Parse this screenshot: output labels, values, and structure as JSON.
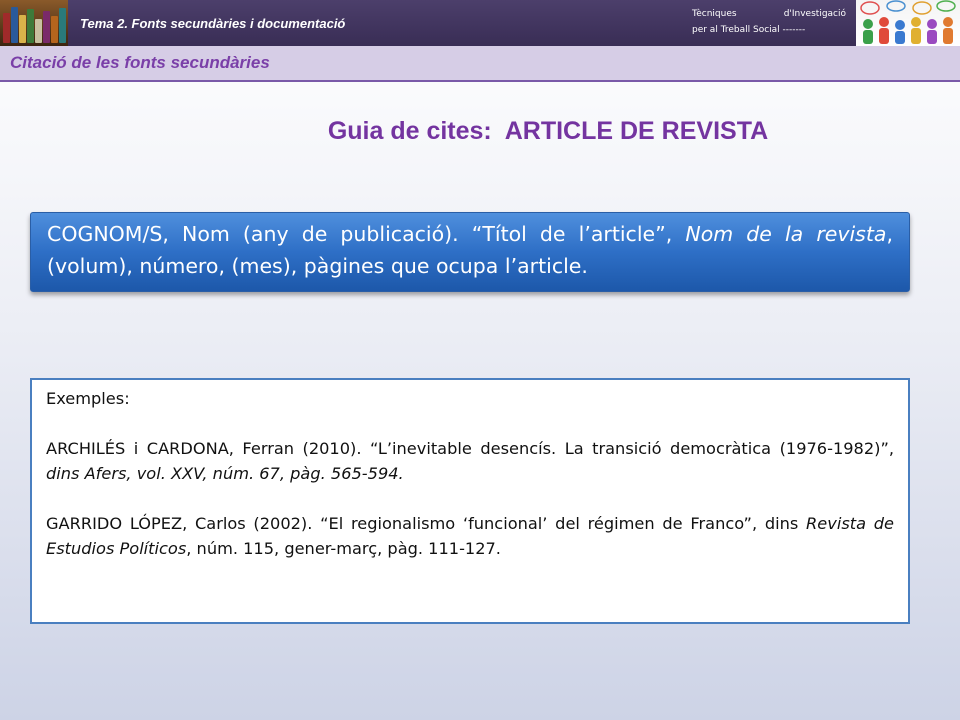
{
  "header": {
    "title": "Tema 2. Fonts secundàries i documentació",
    "course_line1_a": "Tècniques",
    "course_line1_b": "d'Investigació",
    "course_line2": "per al Treball Social -------"
  },
  "section": {
    "title": "Citació de les fonts secundàries"
  },
  "main": {
    "title_a": "Guia de cites:",
    "title_b": "ARTICLE DE REVISTA"
  },
  "format": {
    "part1": "COGNOM/S, Nom (any de publicació). “Títol de l’article”, ",
    "part2_italic": "Nom de la revista",
    "part3": ", (volum), número, (mes), pàgines que ocupa l’article."
  },
  "examples": {
    "heading": "Exemples:",
    "ex1_part1": "ARCHILÉS i CARDONA, Ferran (2010). “L’inevitable desencís. La transició democràtica (1976-1982)”, ",
    "ex1_italic": "dins Afers, vol. XXV, núm. 67, pàg. 565-594.",
    "ex2_part1": "GARRIDO LÓPEZ, Carlos (2002). “El regionalismo ‘funcional’ del régimen de Franco”, dins ",
    "ex2_italic": "Revista de Estudios Políticos",
    "ex2_part2": ", núm. 115, gener-març, pàg. 111-127."
  }
}
